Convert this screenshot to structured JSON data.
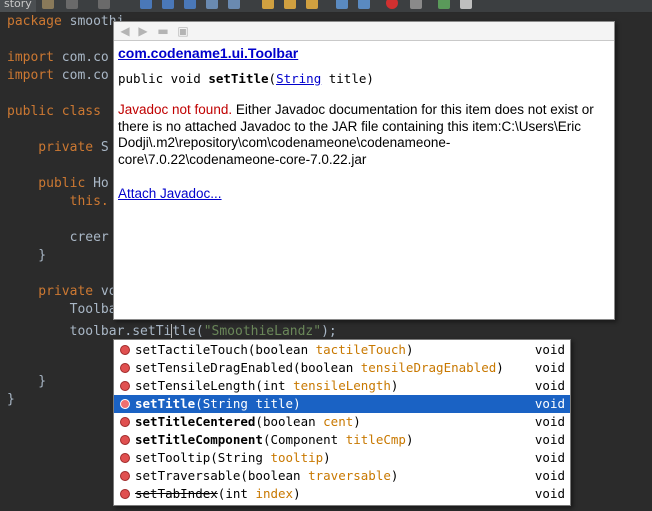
{
  "toolbar": {
    "tab_label": "story"
  },
  "code": {
    "lines": [
      {
        "kw": "package ",
        "text": "smoothi"
      },
      {
        "kw": "",
        "text": ""
      },
      {
        "kw": "import ",
        "text": "com.co"
      },
      {
        "kw": "import ",
        "text": "com.co"
      },
      {
        "kw": "",
        "text": ""
      },
      {
        "kw": "public class ",
        "text": ""
      },
      {
        "kw": "",
        "text": ""
      },
      {
        "kw": "    private ",
        "text": "S"
      },
      {
        "kw": "",
        "text": ""
      },
      {
        "kw": "    public ",
        "text": "Ho"
      },
      {
        "kw": "        this.",
        "text": ""
      },
      {
        "kw": "",
        "text": ""
      },
      {
        "kw": "",
        "text": "        creer"
      },
      {
        "kw": "",
        "text": "    }"
      },
      {
        "kw": "",
        "text": ""
      },
      {
        "kw": "    private ",
        "text": "vo"
      },
      {
        "kw": "",
        "text": "        Toolba"
      },
      {
        "kw": "",
        "text": ""
      },
      {
        "kw": "",
        "text": ""
      },
      {
        "kw": "",
        "text": ""
      },
      {
        "kw": "",
        "text": "    }"
      },
      {
        "kw": "",
        "text": "}"
      }
    ],
    "current_line": {
      "before": "        toolbar.setTi",
      "after": "tle(",
      "string": "\"SmoothieLandz\"",
      "end": ");"
    }
  },
  "doc": {
    "class_name": "com.codename1.ui.Toolbar",
    "sig_prefix": "public void ",
    "sig_method": "setTitle",
    "sig_open": "(",
    "sig_type": "String",
    "sig_rest": " title)",
    "not_found": "Javadoc not found.",
    "message": " Either Javadoc documentation for this item does not exist or there is no attached Javadoc to the JAR file containing this item:C:\\Users\\Eric Dodji\\.m2\\repository\\com\\codenameone\\codenameone-core\\7.0.22\\codenameone-core-7.0.22.jar",
    "attach_link": "Attach Javadoc..."
  },
  "completion": {
    "items": [
      {
        "name": "setTactileTouch",
        "pre": "(boolean ",
        "param": "tactileTouch",
        "post": ")",
        "ret": "void",
        "bold": false,
        "selected": false,
        "strike": false
      },
      {
        "name": "setTensileDragEnabled",
        "pre": "(boolean ",
        "param": "tensileDragEnabled",
        "post": ")",
        "ret": "void",
        "bold": false,
        "selected": false,
        "strike": false
      },
      {
        "name": "setTensileLength",
        "pre": "(int ",
        "param": "tensileLength",
        "post": ")",
        "ret": "void",
        "bold": false,
        "selected": false,
        "strike": false
      },
      {
        "name": "setTitle",
        "pre": "(String ",
        "param": "title",
        "post": ")",
        "ret": "void",
        "bold": true,
        "selected": true,
        "strike": false
      },
      {
        "name": "setTitleCentered",
        "pre": "(boolean ",
        "param": "cent",
        "post": ")",
        "ret": "void",
        "bold": true,
        "selected": false,
        "strike": false
      },
      {
        "name": "setTitleComponent",
        "pre": "(Component ",
        "param": "titleCmp",
        "post": ")",
        "ret": "void",
        "bold": true,
        "selected": false,
        "strike": false
      },
      {
        "name": "setTooltip",
        "pre": "(String ",
        "param": "tooltip",
        "post": ")",
        "ret": "void",
        "bold": false,
        "selected": false,
        "strike": false
      },
      {
        "name": "setTraversable",
        "pre": "(boolean ",
        "param": "traversable",
        "post": ")",
        "ret": "void",
        "bold": false,
        "selected": false,
        "strike": false
      },
      {
        "name": "setTabIndex",
        "pre": "(int ",
        "param": "index",
        "post": ")",
        "ret": "void",
        "bold": false,
        "selected": false,
        "strike": true
      }
    ]
  },
  "colors": {
    "editor_bg": "#2b2b2b",
    "keyword": "#cc7832",
    "string": "#6a8759",
    "selection": "#1a62c4",
    "link": "#0000cc",
    "error_text": "#c00000"
  }
}
